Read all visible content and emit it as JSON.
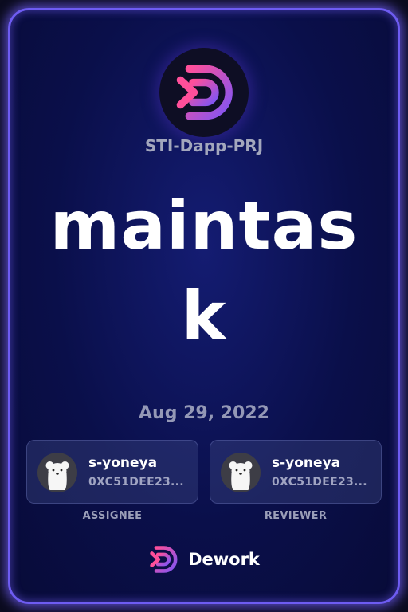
{
  "project": {
    "name": "STI-Dapp-PRJ",
    "logo_icon": "dework-logo-icon"
  },
  "task": {
    "title": "maintask",
    "date": "Aug 29, 2022"
  },
  "assignee": {
    "username": "s-yoneya",
    "address": "0XC51DEE23...",
    "role": "ASSIGNEE",
    "avatar_icon": "polar-bear-avatar-icon"
  },
  "reviewer": {
    "username": "s-yoneya",
    "address": "0XC51DEE23...",
    "role": "REVIEWER",
    "avatar_icon": "polar-bear-avatar-icon"
  },
  "footer": {
    "brand": "Dework",
    "brand_icon": "dework-logo-icon"
  },
  "colors": {
    "accent": "#6e5cf2",
    "card_bg": "#0a0f4a",
    "logo_pink": "#ee4fa8",
    "logo_purple": "#7e55f5"
  }
}
